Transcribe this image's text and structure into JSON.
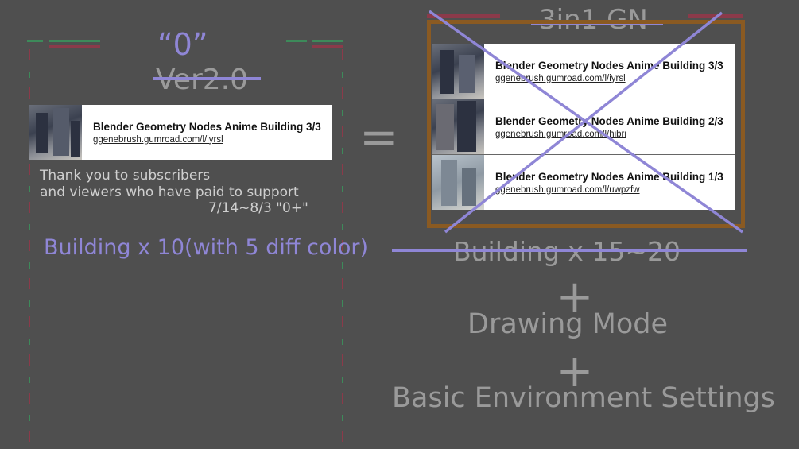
{
  "left": {
    "quote_label": "“0”",
    "version_label": "Ver2.0",
    "card": {
      "title": "Blender Geometry Nodes Anime Building 3/3",
      "url": "ggenebrush.gumroad.com/l/iyrsl"
    },
    "thanks_line1": "Thank you to subscribers",
    "thanks_line2": "and viewers who have paid to support",
    "dates": "7/14~8/3 \"0+\"",
    "building_count": "Building x 10(with 5 diff color)"
  },
  "equals": "=",
  "right": {
    "bundle_title": "3in1 GN",
    "cards": [
      {
        "title": "Blender Geometry Nodes Anime Building 3/3",
        "url": "ggenebrush.gumroad.com/l/iyrsl"
      },
      {
        "title": "Blender Geometry Nodes Anime Building 2/3",
        "url": "ggenebrush.gumroad.com/l/hibri"
      },
      {
        "title": "Blender Geometry Nodes Anime Building 1/3",
        "url": "ggenebrush.gumroad.com/l/uwpzfw"
      }
    ],
    "building_count": "Building x 15~20",
    "plus1": "+",
    "drawing_mode": "Drawing Mode",
    "plus2": "+",
    "environment": "Basic Environment Settings"
  },
  "colors": {
    "background": "#4f4f4f",
    "accent_purple": "#8f86d6",
    "muted_text": "#9a9a9a",
    "frame_orange": "#8a5a22"
  }
}
